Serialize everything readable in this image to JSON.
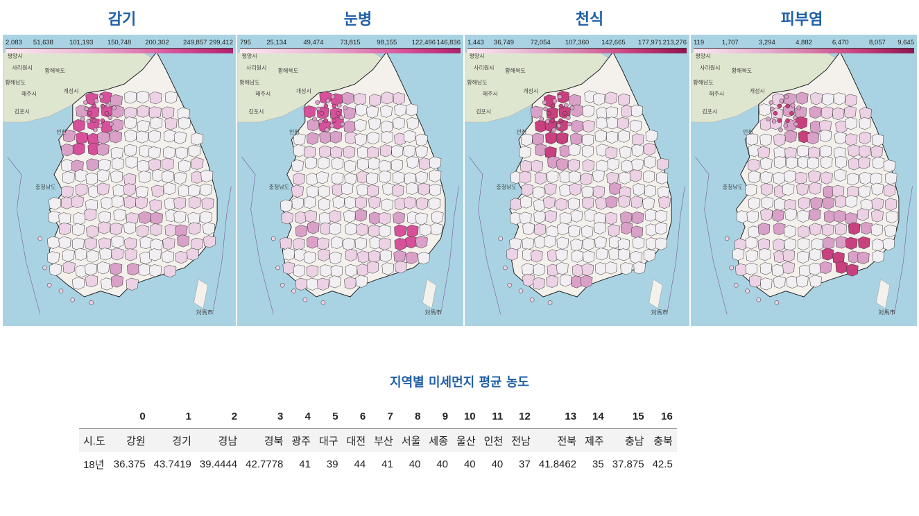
{
  "maps": [
    {
      "title": "감기",
      "legend_ticks": [
        "2,083",
        "51,638",
        "101,193",
        "150,748",
        "200,302",
        "249,857",
        "299,412"
      ],
      "accent": "#d6509a"
    },
    {
      "title": "눈병",
      "legend_ticks": [
        "795",
        "25,134",
        "49,474",
        "73,815",
        "98,155",
        "122,496",
        "146,836"
      ],
      "accent": "#d6509a"
    },
    {
      "title": "천식",
      "legend_ticks": [
        "1,443",
        "36,749",
        "72,054",
        "107,360",
        "142,665",
        "177,971",
        "213,276"
      ],
      "accent": "#c8407e"
    },
    {
      "title": "피부염",
      "legend_ticks": [
        "119",
        "1,707",
        "3,294",
        "4,882",
        "6,470",
        "8,057",
        "9,645"
      ],
      "accent": "#c8407e"
    }
  ],
  "map_labels": {
    "pyongyang": "평양시",
    "sariwon": "사리원시",
    "hwanghae_n": "황해북도",
    "hwanghae_s": "황해남도",
    "haeju": "해주시",
    "kaesong": "개성시",
    "gimpo": "김포시",
    "incheon": "인천",
    "chungcheong": "충청남도",
    "tsushima": "対馬市"
  },
  "table": {
    "title": "지역별 미세먼지 평균 농도",
    "columns": [
      "0",
      "1",
      "2",
      "3",
      "4",
      "5",
      "6",
      "7",
      "8",
      "9",
      "10",
      "11",
      "12",
      "13",
      "14",
      "15",
      "16"
    ],
    "index_label": "시.도",
    "regions": [
      "강원",
      "경기",
      "경남",
      "경북",
      "광주",
      "대구",
      "대전",
      "부산",
      "서울",
      "세종",
      "울산",
      "인천",
      "전남",
      "전북",
      "제주",
      "충남",
      "충북"
    ],
    "row_label": "18년",
    "values": [
      "36.375",
      "43.7419",
      "39.4444",
      "42.7778",
      "41",
      "39",
      "44",
      "41",
      "40",
      "40",
      "40",
      "40",
      "37",
      "41.8462",
      "35",
      "37.875",
      "42.5"
    ]
  },
  "colors": {
    "title_blue": "#1f5fa8",
    "sea": "#a9d3e3",
    "land": "#f4f1ec",
    "north_land": "#dfe6cf",
    "pink_light": "#ecd2e4",
    "pink_mid": "#d9a0c8",
    "pink_dark": "#d6509a"
  }
}
